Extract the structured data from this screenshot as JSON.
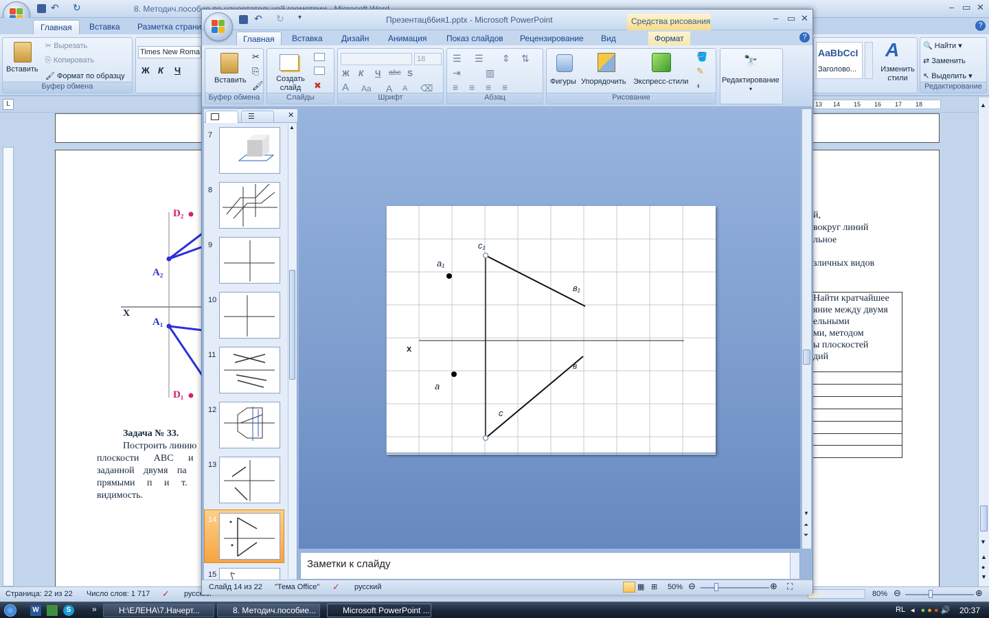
{
  "word": {
    "title": "8. Методич.пособие по начертательной геометрии - Microsoft Word",
    "tabs": [
      "Главная",
      "Вставка",
      "Разметка страни"
    ],
    "ribbon": {
      "paste": "Вставить",
      "cut": "Вырезать",
      "copy": "Копировать",
      "format_painter": "Формат по образцу",
      "clipboard_group": "Буфер обмена",
      "font_name": "Times New Roma",
      "bold": "Ж",
      "italic": "К",
      "underline": "Ч",
      "style_preview": "AaBbCcI",
      "style_name": "Заголово...",
      "change_styles": "Изменить стили",
      "find": "Найти",
      "replace": "Заменить",
      "select": "Выделить",
      "editing_group": "Редактирование"
    },
    "ruler_marks": [
      "13",
      "14",
      "15",
      "16",
      "17",
      "18"
    ],
    "document": {
      "labels": {
        "d2": "D₂",
        "a2": "A₂",
        "x": "X",
        "a1": "A₁",
        "d1": "D₁"
      },
      "task_title": "Задача № 33.",
      "task_lines": [
        "Построить линию",
        "плоскости ABC и",
        "заданной двумя па",
        "прямыми п и т.",
        "видимость."
      ],
      "right_lines": [
        "й,",
        "вокруг линий",
        "льное",
        "зличных видов"
      ],
      "table_text": [
        "Найти кратчайшее",
        "яние между двумя",
        "ельными",
        "ми, методом",
        "ы плоскостей",
        "дий"
      ]
    },
    "status": {
      "page": "Страница: 22 из 22",
      "words": "Число слов: 1 717",
      "lang": "русский",
      "zoom": "80%"
    }
  },
  "ppt": {
    "title": "Презентац66ия1.pptx - Microsoft PowerPoint",
    "tools_context": "Средства рисования",
    "tabs": [
      "Главная",
      "Вставка",
      "Дизайн",
      "Анимация",
      "Показ слайдов",
      "Рецензирование",
      "Вид",
      "Формат"
    ],
    "ribbon": {
      "paste": "Вставить",
      "clipboard_group": "Буфер обмена",
      "new_slide": "Создать слайд",
      "slides_group": "Слайды",
      "font_size": "18",
      "bold": "Ж",
      "italic": "К",
      "underline": "Ч",
      "strike": "abc",
      "shadow": "S",
      "font_group": "Шрифт",
      "paragraph_group": "Абзац",
      "shapes": "Фигуры",
      "arrange": "Упорядочить",
      "quick_styles": "Экспресс-стили",
      "drawing_group": "Рисование",
      "editing": "Редактирование"
    },
    "thumbnails": [
      "7",
      "8",
      "9",
      "10",
      "11",
      "12",
      "13",
      "14",
      "15"
    ],
    "selected_slide": "14",
    "slide_labels": {
      "c1": "c₁",
      "a1": "a₁",
      "b1": "в₁",
      "x": "x",
      "a": "a",
      "b": "в",
      "c": "c"
    },
    "notes_placeholder": "Заметки к слайду",
    "status": {
      "slide": "Слайд 14 из 22",
      "theme": "\"Тема Office\"",
      "lang": "русский",
      "zoom": "50%"
    }
  },
  "taskbar": {
    "tasks": [
      "H:\\ЕЛЕНА\\7.Начерт...",
      "8. Методич.пособие...",
      "Microsoft PowerPoint ..."
    ],
    "lang": "RL",
    "clock": "20:37"
  }
}
